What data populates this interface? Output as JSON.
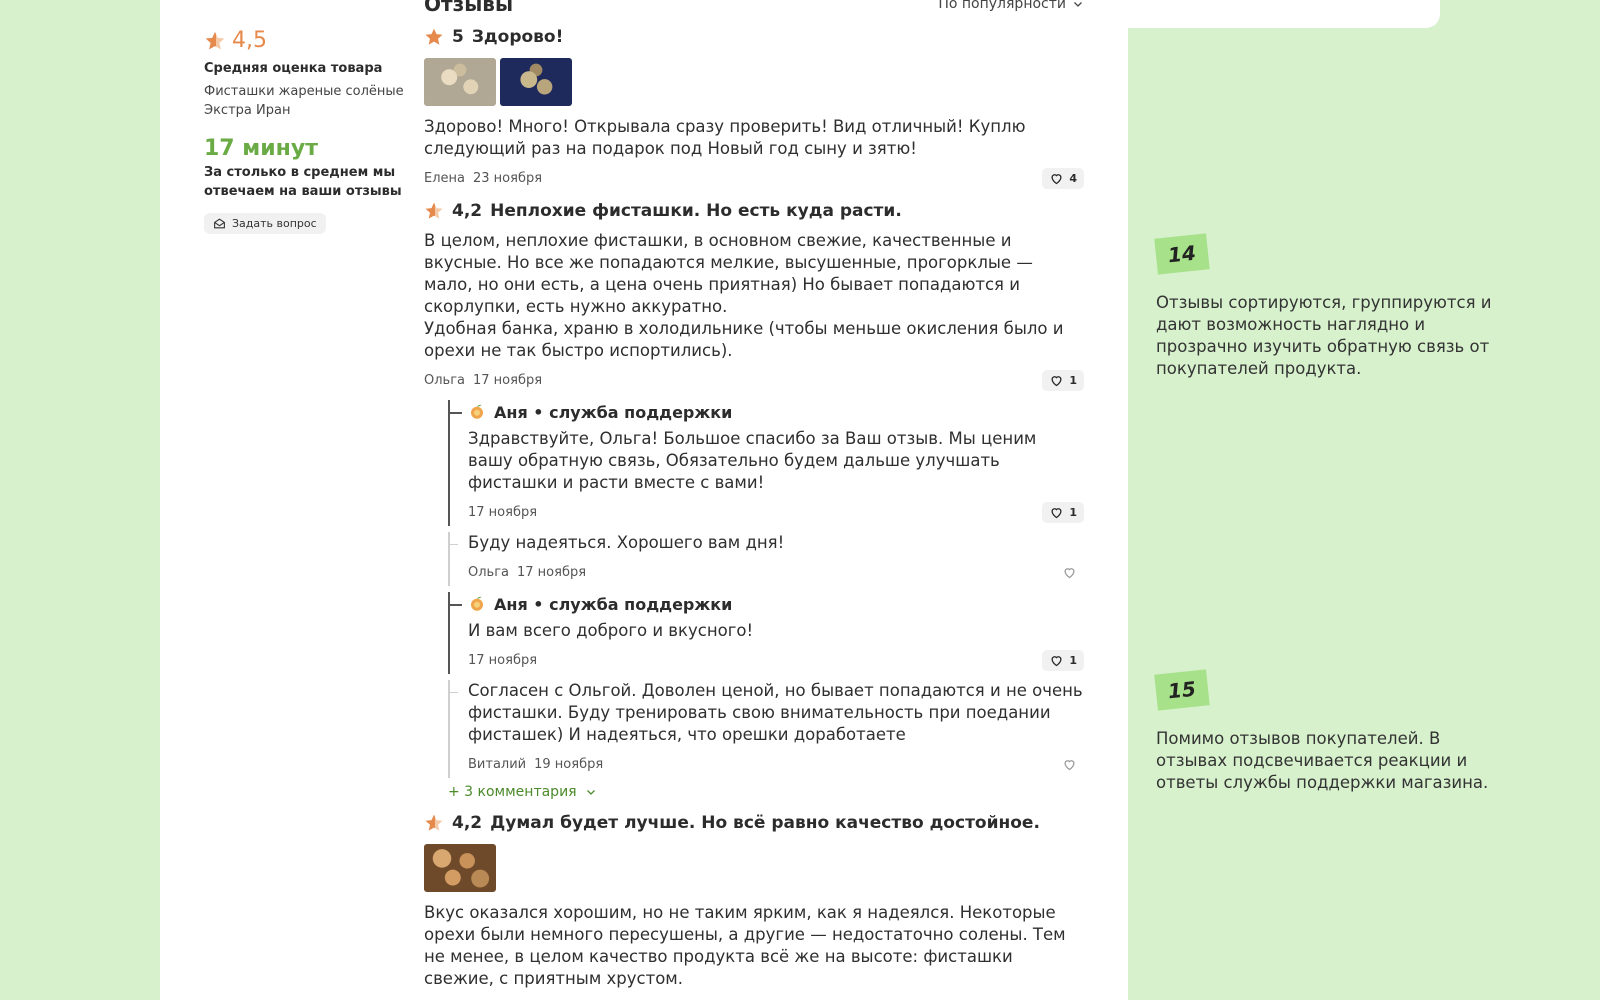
{
  "summary": {
    "rating": "4,5",
    "rating_label": "Средняя оценка товара",
    "product_name": "Фисташки жареные солёные Экстра Иран",
    "response_time": "17 минут",
    "response_label": "За столько в среднем мы отвечаем на ваши отзывы",
    "ask_button": "Задать вопрос"
  },
  "reviews_header": {
    "title": "Отзывы",
    "sort": "По популярности"
  },
  "reviews": [
    {
      "rating": "5",
      "title": "Здорово!",
      "text": "Здорово! Много! Открывала сразу проверить! Вид отличный! Куплю следующий раз на подарок под Новый год сыну и зятю!",
      "author": "Елена",
      "date": "23 ноября",
      "likes": "4"
    },
    {
      "rating": "4,2",
      "title": "Неплохие фисташки. Но есть куда расти.",
      "text": "В целом, неплохие фисташки, в основном свежие, качественные и вкусные. Но все же попадаются мелкие, высушенные, прогорклые — мало, но они есть, а цена очень приятная) Но бывает попадаются и скорлупки, есть нужно аккуратно.\nУдобная банка, храню в холодильнике (чтобы меньше окисления было и орехи не так быстро испортились).",
      "author": "Ольга",
      "date": "17 ноября",
      "likes": "1"
    },
    {
      "rating": "4,2",
      "title": "Думал будет лучше. Но всё равно качество достойное.",
      "text": "Вкус оказался хорошим, но не таким ярким, как я надеялся. Некоторые орехи были немного пересушены, а другие — недостаточно солены. Тем не менее, в целом качество продукта всё же на высоте: фисташки свежие, с приятным хрустом."
    }
  ],
  "replies": [
    {
      "author": "Аня • служба поддержки",
      "text": "Здравствуйте, Ольга! Большое спасибо за Ваш отзыв. Мы ценим вашу обратную связь, Обязательно будем дальше улучшать фисташки и расти вместе с вами!",
      "date": "17 ноября",
      "likes": "1"
    },
    {
      "text": "Буду надеяться. Хорошего вам дня!",
      "author": "Ольга",
      "date": "17 ноября"
    },
    {
      "author": "Аня • служба поддержки",
      "text": "И вам всего доброго и вкусного!",
      "date": "17 ноября",
      "likes": "1"
    },
    {
      "text": "Согласен с Ольгой. Доволен ценой, но бывает попадаются и не очень фисташки. Буду тренировать свою внимательность при поедании фисташек) И надеяться, что орешки доработаете",
      "author": "Виталий",
      "date": "19 ноября"
    }
  ],
  "more_comments": "+ 3 комментария",
  "notes": [
    {
      "number": "14",
      "text": "Отзывы сортируются, группируются и дают возможность наглядно и прозрачно изучить обратную связь от покупателей продукта."
    },
    {
      "number": "15",
      "text": "Помимо отзывов покупателей. В отзывах подсвечивается реакции и ответы службы поддержки магазина."
    }
  ],
  "colors": {
    "background": "#d7f1cd",
    "accent_orange": "#e5894c",
    "accent_green": "#6aab45",
    "badge_green": "#a7e18a"
  },
  "icons": [
    "star-icon",
    "half-star-icon",
    "heart-icon",
    "chevron-down-icon",
    "mail-icon",
    "peach-avatar-icon"
  ]
}
